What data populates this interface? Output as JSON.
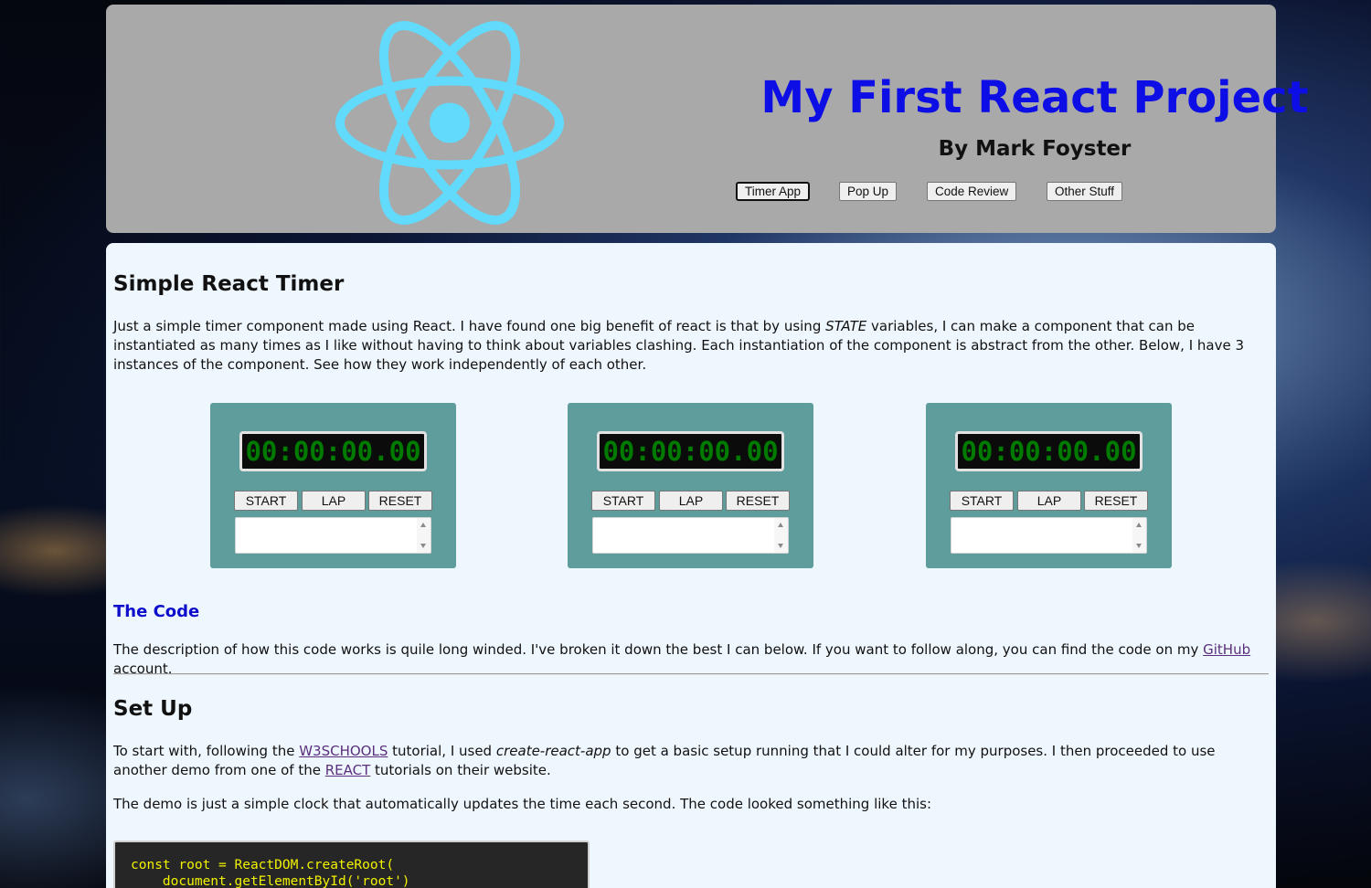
{
  "header": {
    "title": "My First React Project",
    "subtitle": "By Mark Foyster",
    "nav": [
      {
        "label": "Timer App",
        "active": true
      },
      {
        "label": "Pop Up",
        "active": false
      },
      {
        "label": "Code Review",
        "active": false
      },
      {
        "label": "Other Stuff",
        "active": false
      }
    ],
    "logo_color": "#61dafb",
    "background_color": "#a9a9a9"
  },
  "main": {
    "section_title": "Simple React Timer",
    "intro": {
      "before": "Just a simple timer component made using React. I have found one big benefit of react is that by using ",
      "emphasis": "STATE",
      "after": " variables, I can make a component that can be instantiated as many times as I like without having to think about variables clashing. Each instantiation of the component is abstract from the other. Below, I have 3 instances of the component. See how they work independently of each other."
    },
    "timers": [
      {
        "display": "00:00:00.00",
        "start": "START",
        "lap": "LAP",
        "reset": "RESET"
      },
      {
        "display": "00:00:00.00",
        "start": "START",
        "lap": "LAP",
        "reset": "RESET"
      },
      {
        "display": "00:00:00.00",
        "start": "START",
        "lap": "LAP",
        "reset": "RESET"
      }
    ],
    "code_heading": "The Code",
    "code_desc": {
      "before": "The description of how this code works is quile long winded. I've broken it down the best I can below. If you want to follow along, you can find the code on my ",
      "link": "GitHub",
      "after": " account."
    },
    "setup_title": "Set Up",
    "setup_p1": {
      "t1": "To start with, following the ",
      "link1": "W3SCHOOLS",
      "t2": " tutorial, I used ",
      "em": "create-react-app",
      "t3": " to get a basic setup running that I could alter for my purposes. I then proceeded to use another demo from one of the ",
      "link2": "REACT",
      "t4": " tutorials on their website."
    },
    "setup_p2": "The demo is just a simple clock that automatically updates the time each second. The code looked something like this:",
    "code_lines": [
      "const root = ReactDOM.createRoot(",
      "    document.getElementById('root')"
    ]
  }
}
